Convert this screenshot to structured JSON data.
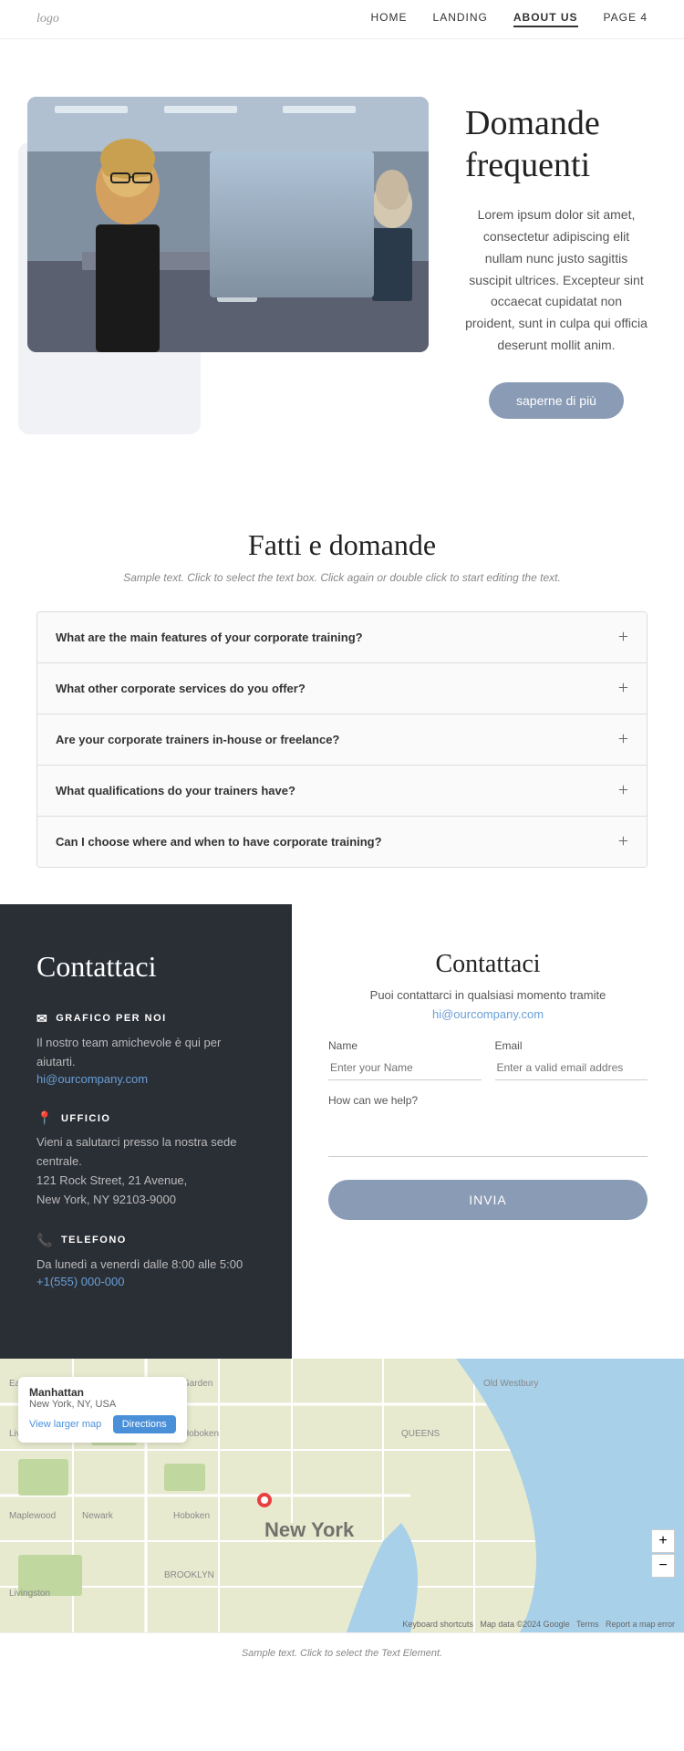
{
  "nav": {
    "logo": "logo",
    "links": [
      {
        "label": "HOME",
        "active": false
      },
      {
        "label": "LANDING",
        "active": false
      },
      {
        "label": "ABOUT US",
        "active": true
      },
      {
        "label": "PAGE 4",
        "active": false
      }
    ]
  },
  "hero": {
    "title": "Domande frequenti",
    "body": "Lorem ipsum dolor sit amet, consectetur adipiscing elit nullam nunc justo sagittis suscipit ultrices. Excepteur sint occaecat cupidatat non proident, sunt in culpa qui officia deserunt mollit anim.",
    "button_label": "saperne di più"
  },
  "faq_section": {
    "title": "Fatti e domande",
    "subtitle": "Sample text. Click to select the text box. Click again or double click to start editing the text.",
    "items": [
      {
        "question": "What are the main features of your corporate training?"
      },
      {
        "question": "What other corporate services do you offer?"
      },
      {
        "question": "Are your corporate trainers in-house or freelance?"
      },
      {
        "question": "What qualifications do your trainers have?"
      },
      {
        "question": "Can I choose where and when to have corporate training?"
      }
    ]
  },
  "contact_left": {
    "title": "Contattaci",
    "sections": [
      {
        "icon": "✉",
        "label": "GRAFICO PER NOI",
        "text": "Il nostro team amichevole è qui per aiutarti.",
        "link": "hi@ourcompany.com"
      },
      {
        "icon": "📍",
        "label": "UFFICIO",
        "text": "Vieni a salutarci presso la nostra sede centrale.\n121 Rock Street, 21 Avenue,\nNew York, NY 92103-9000"
      },
      {
        "icon": "📞",
        "label": "TELEFONO",
        "text": "Da lunedì a venerdì dalle 8:00 alle 5:00",
        "link": "+1(555) 000-000"
      }
    ]
  },
  "contact_right": {
    "title": "Contattaci",
    "subtitle": "Puoi contattarci in qualsiasi momento tramite",
    "email": "hi@ourcompany.com",
    "name_label": "Name",
    "name_placeholder": "Enter your Name",
    "email_label": "Email",
    "email_placeholder": "Enter a valid email addres",
    "howhelp_label": "How can we help?",
    "submit_label": "INVIA"
  },
  "map": {
    "location_name": "Manhattan",
    "location_address": "New York, NY, USA",
    "directions_label": "Directions",
    "larger_map_label": "View larger map",
    "city_label": "New York",
    "zoom_in": "+",
    "zoom_out": "−"
  },
  "footer": {
    "text": "Sample text. Click to select the Text Element."
  }
}
